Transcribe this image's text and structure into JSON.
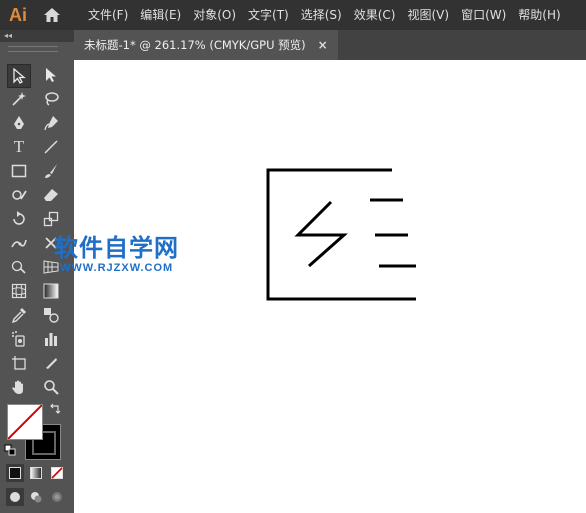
{
  "app": {
    "logo": "Ai"
  },
  "menu": [
    {
      "label": "文件(F)"
    },
    {
      "label": "编辑(E)"
    },
    {
      "label": "对象(O)"
    },
    {
      "label": "文字(T)"
    },
    {
      "label": "选择(S)"
    },
    {
      "label": "效果(C)"
    },
    {
      "label": "视图(V)"
    },
    {
      "label": "窗口(W)"
    },
    {
      "label": "帮助(H)"
    }
  ],
  "document_tab": {
    "title": "未标题-1* @ 261.17% (CMYK/GPU 预览)",
    "close": "×"
  },
  "toolbar": {
    "collapse": "◂◂"
  },
  "watermark": {
    "title": "软件自学网",
    "url": "WWW.RJZXW.COM"
  },
  "colors": {
    "accent": "#e08a3c",
    "watermark": "#1f6fc7",
    "fill_none_slash": "#d40000"
  }
}
